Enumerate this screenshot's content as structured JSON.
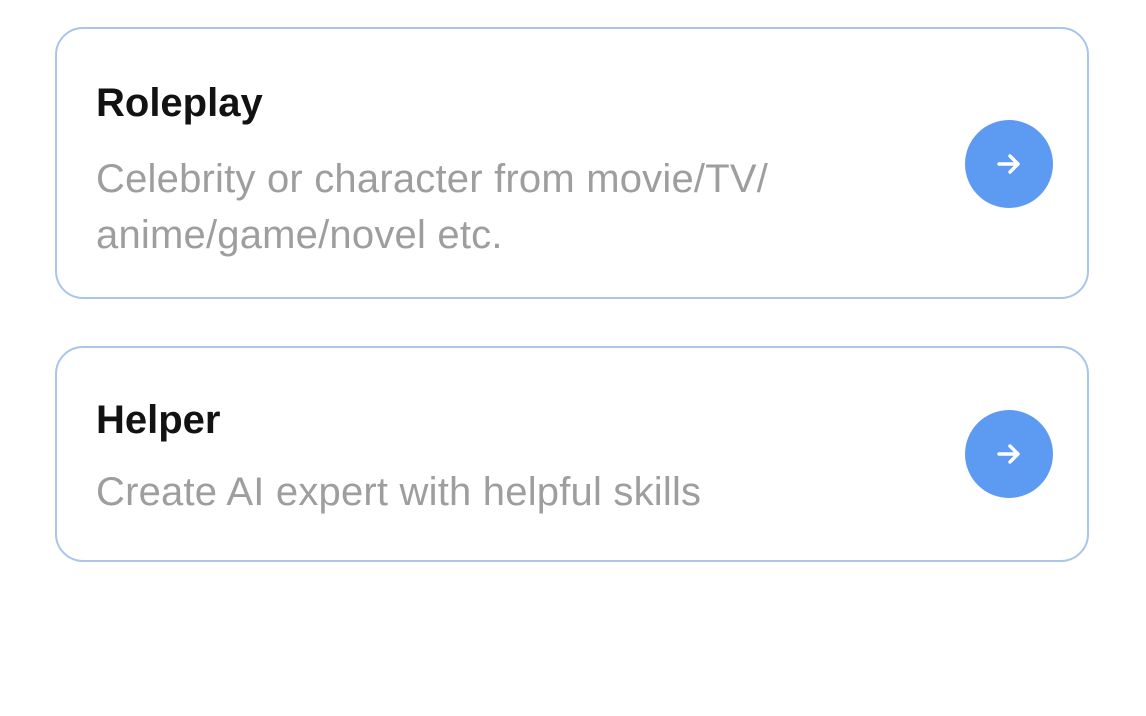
{
  "cards": [
    {
      "title": "Roleplay",
      "description": "Celebrity or character from movie/TV/ anime/game/novel etc.",
      "icon": "arrow-right-icon"
    },
    {
      "title": "Helper",
      "description": "Create AI expert with helpful skills",
      "icon": "arrow-right-icon"
    }
  ],
  "colors": {
    "accent": "#5d9bf3",
    "card_border": "#a9c6ea",
    "title_text": "#121212",
    "description_text": "#9e9e9e"
  }
}
